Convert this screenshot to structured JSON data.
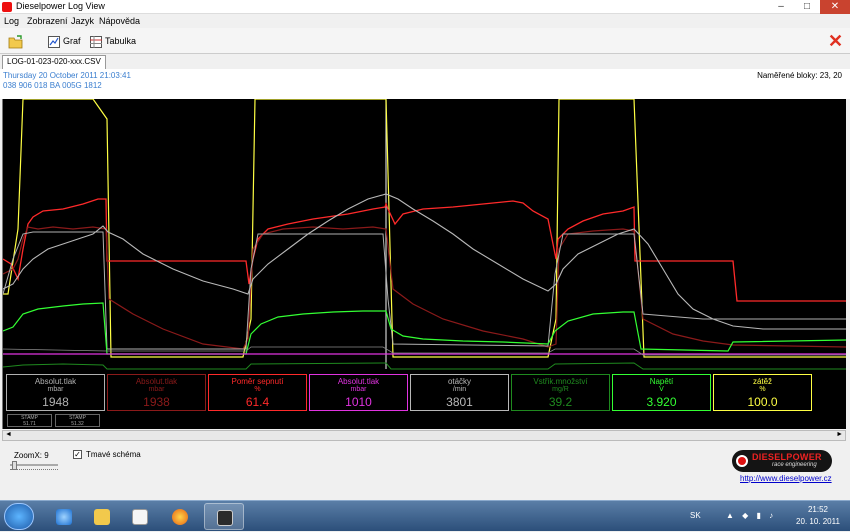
{
  "window": {
    "title": "Dieselpower Log View",
    "min": "–",
    "max": "□",
    "close": "✕"
  },
  "menu": [
    "Log",
    "Zobrazení",
    "Jazyk",
    "Nápověda"
  ],
  "toolbar": {
    "graph_label": "Graf",
    "table_label": "Tabulka",
    "close_glyph": "✕"
  },
  "tab": {
    "label": "LOG-01-023-020-xxx.CSV"
  },
  "info": {
    "date": "Thursday 20 October 2011 21:03:41",
    "ecu": "038 906 018 BA  005G  1812",
    "blocks": "Naměřené bloky: 23, 20"
  },
  "colors": {
    "bg": "#000000",
    "accent_red": "#ff2222",
    "grid": "#555555"
  },
  "gauges": [
    {
      "name": "Absolut.tlak",
      "unit": "mbar",
      "value": "1948",
      "color": "#b0b0b0"
    },
    {
      "name": "Absolut.tlak",
      "unit": "mbar",
      "value": "1938",
      "color": "#8b1a1a"
    },
    {
      "name": "Poměr sepnutí",
      "unit": "%",
      "value": "61.4",
      "color": "#ff2a2a"
    },
    {
      "name": "Absolut.tlak",
      "unit": "mbar",
      "value": "1010",
      "color": "#e033e0"
    },
    {
      "name": "otáčky",
      "unit": "/min",
      "value": "3801",
      "color": "#b8b8b8"
    },
    {
      "name": "Vstřik.množství",
      "unit": "mg/R",
      "value": "39.2",
      "color": "#1f8a1f"
    },
    {
      "name": "Napětí",
      "unit": "V",
      "value": "3.920",
      "color": "#33ff33"
    },
    {
      "name": "zátěž",
      "unit": "%",
      "value": "100.0",
      "color": "#ffff44"
    }
  ],
  "stamps": [
    {
      "label": "STAMP",
      "value": "51.71"
    },
    {
      "label": "STAMP",
      "value": "51.32"
    }
  ],
  "scroll": {
    "left": "◄",
    "right": "►"
  },
  "bottom": {
    "zoom_label": "ZoomX: 9",
    "zoom_value": 9,
    "checkbox_label": "Tmavé schéma",
    "checkbox_checked": true,
    "url": "http://www.dieselpower.cz"
  },
  "logo": {
    "text": "DIESELPOWER",
    "tagline": "race engineering"
  },
  "taskbar": {
    "lang": "SK",
    "time": "21:52",
    "date": "20. 10. 2011",
    "apps": [
      "ie-icon",
      "explorer-icon",
      "media-player-icon",
      "firefox-icon",
      "logview-icon"
    ]
  }
}
